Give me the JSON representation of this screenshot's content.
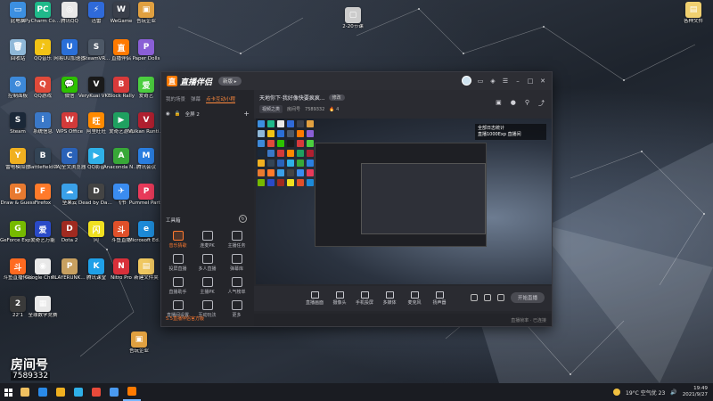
{
  "desktop": {
    "icons": [
      {
        "label": "此电脑",
        "color": "#3c8fe0",
        "glyph": "▭"
      },
      {
        "label": "PyCharm Commun...",
        "color": "#1fb98a",
        "glyph": "PC"
      },
      {
        "label": "腾讯QQ",
        "color": "#e8e8e8",
        "glyph": "◎"
      },
      {
        "label": "迅雷",
        "color": "#2f6ad9",
        "glyph": "⚡"
      },
      {
        "label": "WeGame",
        "color": "#3a3f4a",
        "glyph": "W"
      },
      {
        "label": "吾玩企业",
        "color": "#e0a040",
        "glyph": "▣"
      },
      {
        "label": "回收站",
        "color": "#8fb8d8",
        "glyph": "🗑"
      },
      {
        "label": "QQ音乐",
        "color": "#f2c315",
        "glyph": "♪"
      },
      {
        "label": "网易UU加速器",
        "color": "#2a6fd8",
        "glyph": "U"
      },
      {
        "label": "SteamVR...",
        "color": "#4d5866",
        "glyph": "S"
      },
      {
        "label": "直播伴侣",
        "color": "#ff7a00",
        "glyph": "直"
      },
      {
        "label": "Paper Dolls",
        "color": "#8a5fd6",
        "glyph": "P"
      },
      {
        "label": "控制面板",
        "color": "#3d89d9",
        "glyph": "⚙"
      },
      {
        "label": "QQ游戏",
        "color": "#e04a3a",
        "glyph": "Q"
      },
      {
        "label": "微信",
        "color": "#2dc100",
        "glyph": "💬"
      },
      {
        "label": "VeryKuai VK加速器",
        "color": "#1a1a1a",
        "glyph": "V"
      },
      {
        "label": "Block Rally",
        "color": "#d83a3a",
        "glyph": "B"
      },
      {
        "label": "爱奇艺",
        "color": "#4ccf40",
        "glyph": "爱"
      },
      {
        "label": "Steam",
        "color": "#1b2838",
        "glyph": "S"
      },
      {
        "label": "系统信息",
        "color": "#3a78c8",
        "glyph": "i"
      },
      {
        "label": "WPS Office",
        "color": "#d23a3a",
        "glyph": "W"
      },
      {
        "label": "阿里旺旺",
        "color": "#ff8a00",
        "glyph": "旺"
      },
      {
        "label": "爱奇艺游戏",
        "color": "#1fa060",
        "glyph": "▶"
      },
      {
        "label": "Vulkan Runtime 2019.1",
        "color": "#b02030",
        "glyph": "V"
      },
      {
        "label": "雷电模拟器",
        "color": "#f0b020",
        "glyph": "Y"
      },
      {
        "label": "Battlefield 4",
        "color": "#334455",
        "glyph": "B"
      },
      {
        "label": "CAJ全文浏览器",
        "color": "#2a62b8",
        "glyph": "C"
      },
      {
        "label": "QQ影音",
        "color": "#2fb0e8",
        "glyph": "▶"
      },
      {
        "label": "Anaconda Navigator",
        "color": "#38a838",
        "glyph": "A"
      },
      {
        "label": "腾讯会议",
        "color": "#2a7ee0",
        "glyph": "M"
      },
      {
        "label": "Draw & Guess",
        "color": "#e87a30",
        "glyph": "D"
      },
      {
        "label": "Firefox",
        "color": "#ff7a2a",
        "glyph": "F"
      },
      {
        "label": "坚果云",
        "color": "#3aa0e8",
        "glyph": "☁"
      },
      {
        "label": "Dead by Daylight",
        "color": "#444",
        "glyph": "D"
      },
      {
        "label": "飞书",
        "color": "#3a8cf0",
        "glyph": "✈"
      },
      {
        "label": "Pummel Party",
        "color": "#e83a5a",
        "glyph": "P"
      },
      {
        "label": "GeForce Experience",
        "color": "#76b900",
        "glyph": "G"
      },
      {
        "label": "爱奇艺万能",
        "color": "#2a4ac8",
        "glyph": "爱"
      },
      {
        "label": "Dota 2",
        "color": "#a02a20",
        "glyph": "D"
      },
      {
        "label": "闪",
        "color": "#f0e020",
        "glyph": "闪"
      },
      {
        "label": "斗鱼直播",
        "color": "#e0502a",
        "glyph": "斗"
      },
      {
        "label": "Microsoft Edge",
        "color": "#1d8ad8",
        "glyph": "e"
      },
      {
        "label": "斗鱼直播伴侣",
        "color": "#ff6a20",
        "glyph": "斗"
      },
      {
        "label": "Google Chrome",
        "color": "#e8e8e8",
        "glyph": "◉"
      },
      {
        "label": "PLAYERUNKNOWN'S...",
        "color": "#c8a060",
        "glyph": "P"
      },
      {
        "label": "腾讯课堂",
        "color": "#1fa0e8",
        "glyph": "K"
      },
      {
        "label": "Nitro Pro",
        "color": "#d8303a",
        "glyph": "N"
      },
      {
        "label": "新建文件夹",
        "color": "#f0c860",
        "glyph": "▤"
      },
      {
        "label": "22'1",
        "color": "#3a3a3a",
        "glyph": "2"
      },
      {
        "label": "全球数学竞赛",
        "color": "#e8e8e8",
        "glyph": "▦"
      },
      {
        "label": "吾玩企业",
        "color": "#e0a040",
        "glyph": "▣"
      },
      {
        "label": "2-20节课",
        "color": "#cccccc",
        "glyph": "▢"
      },
      {
        "label": "各种文件",
        "color": "#f0d070",
        "glyph": "▤"
      }
    ]
  },
  "window": {
    "logo_text": "直播伴侣",
    "logo_mark": "直",
    "badge": "新版 ▸",
    "tabs": [
      "我的场景",
      "弹幕",
      "点卡互动小程"
    ],
    "active_tab": 2,
    "scene_label": "全屏 2",
    "tools_title": "工具箱",
    "tools": [
      {
        "label": "音乐猜歌"
      },
      {
        "label": "连麦PK"
      },
      {
        "label": "主播任务"
      },
      {
        "label": "投屏直播"
      },
      {
        "label": "多人直播"
      },
      {
        "label": "弹幕库"
      },
      {
        "label": "直播助手"
      },
      {
        "label": "主播PK"
      },
      {
        "label": "人气榜单"
      },
      {
        "label": "直播间设置"
      },
      {
        "label": "互动玩法"
      },
      {
        "label": "更多"
      }
    ],
    "footer_note": "5.5直播伴侣官方版",
    "stream_title": "天地你下·我好像快要疯疯...",
    "edit_label": "修改",
    "meta_category": "视频之类",
    "meta_room": "房间号",
    "meta_id": "7589332",
    "meta_fans": "🔥 4",
    "preview_banner_line1": "全部日志统计",
    "preview_banner_line2": "直播1000Exp 直播间",
    "controls": [
      {
        "label": "直播画面"
      },
      {
        "label": "摄像头"
      },
      {
        "label": "手机投屏"
      },
      {
        "label": "多媒体"
      },
      {
        "label": "麦克风"
      },
      {
        "label": "扬声器"
      }
    ],
    "live_button": "开始直播",
    "status_text": "直播帧率 · 已连接"
  },
  "corner_watermark": {
    "title": "房间号",
    "number": "7589332"
  },
  "taskbar": {
    "apps": [
      {
        "color": "#f0c060"
      },
      {
        "color": "#2a8ae8"
      },
      {
        "color": "#f0b020"
      },
      {
        "color": "#2fb0e8"
      },
      {
        "color": "#e84a3a"
      },
      {
        "color": "#4a9af0"
      },
      {
        "color": "#ff7a00"
      }
    ],
    "weather": "19°C 空气优 23",
    "time": "19:49",
    "date": "2021/9/27"
  }
}
